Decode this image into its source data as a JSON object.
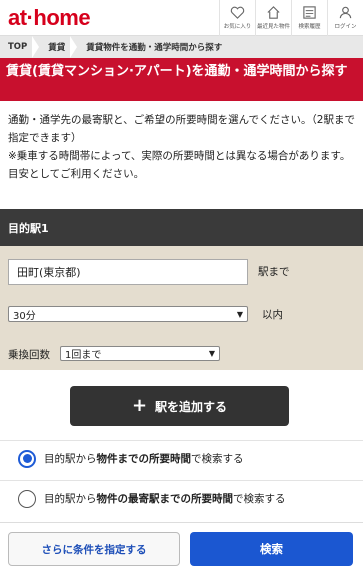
{
  "header": {
    "logo": "at·home",
    "icons": [
      {
        "name": "favorites",
        "label": "お気に入り",
        "icon": "heart-icon"
      },
      {
        "name": "recent",
        "label": "最近見た物件",
        "icon": "house-icon"
      },
      {
        "name": "history",
        "label": "検索履歴",
        "icon": "history-icon"
      },
      {
        "name": "login",
        "label": "ログイン",
        "icon": "user-icon"
      }
    ]
  },
  "breadcrumb": [
    "TOP",
    "賃貸",
    "賃貸物件を通勤・通学時間から探す"
  ],
  "page_title": "賃貸(賃貸マンション·アパート)を通勤・通学時間から探す",
  "intro": {
    "line1": "通勤・通学先の最寄駅と、ご希望の所要時間を選んでください。（2駅まで指定できます）",
    "line2": "※乗車する時間帯によって、実際の所要時間とは異なる場合があります。目安としてご利用ください。"
  },
  "section": {
    "heading": "目的駅1",
    "station_value": "田町(東京都)",
    "station_suffix": "駅まで",
    "time_value": "30分",
    "time_suffix": "以内",
    "transfer_label": "乗換回数",
    "transfer_value": "1回まで"
  },
  "add_station_label": "駅を追加する",
  "radio_options": [
    {
      "prefix": "目的駅から",
      "bold": "物件までの所要時間",
      "suffix": "で検索する",
      "checked": true
    },
    {
      "prefix": "目的駅から",
      "bold": "物件の最寄駅までの所要時間",
      "suffix": "で検索する",
      "checked": false
    }
  ],
  "buttons": {
    "more_conditions": "さらに条件を指定する",
    "search": "検索"
  },
  "colors": {
    "brand_red": "#d6001c",
    "title_red": "#c8102e",
    "search_blue": "#1b57d1",
    "section_dark": "#3a3a3a",
    "section_bg": "#e4ddcf"
  }
}
